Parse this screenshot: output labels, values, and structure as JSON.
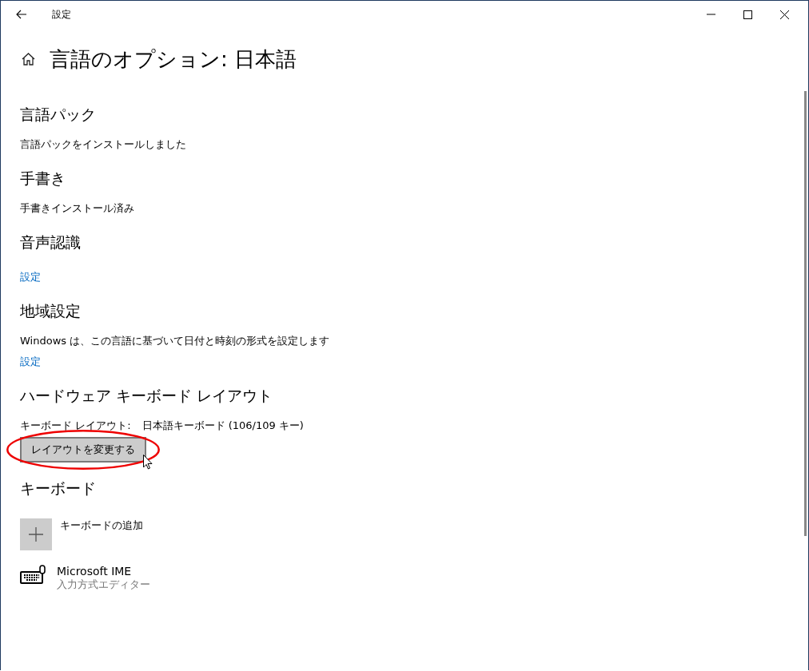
{
  "window": {
    "title": "設定"
  },
  "page_title": "言語のオプション: 日本語",
  "sections": [
    {
      "heading": "言語パック",
      "items": [
        {
          "kind": "text",
          "text": "言語パックをインストールしました"
        }
      ]
    },
    {
      "heading": "手書き",
      "items": [
        {
          "kind": "text",
          "text": "手書きインストール済み"
        }
      ]
    },
    {
      "heading": "音声認識",
      "items": [
        {
          "kind": "link",
          "text": "設定"
        }
      ]
    },
    {
      "heading": "地域設定",
      "items": [
        {
          "kind": "text",
          "text": "Windows は、この言語に基づいて日付と時刻の形式を設定します"
        },
        {
          "kind": "link",
          "text": "設定"
        }
      ]
    },
    {
      "heading": "ハードウェア キーボード レイアウト",
      "items": [
        {
          "kind": "pair",
          "label": "キーボード レイアウト:",
          "value": "日本語キーボード (106/109 キー)"
        },
        {
          "kind": "button",
          "text": "レイアウトを変更する",
          "circled": true
        }
      ]
    },
    {
      "heading": "キーボード",
      "items": [
        {
          "kind": "add",
          "text": "キーボードの追加"
        },
        {
          "kind": "keyboard",
          "text": "Microsoft IME",
          "subtitle": "入力方式エディター"
        }
      ]
    }
  ]
}
